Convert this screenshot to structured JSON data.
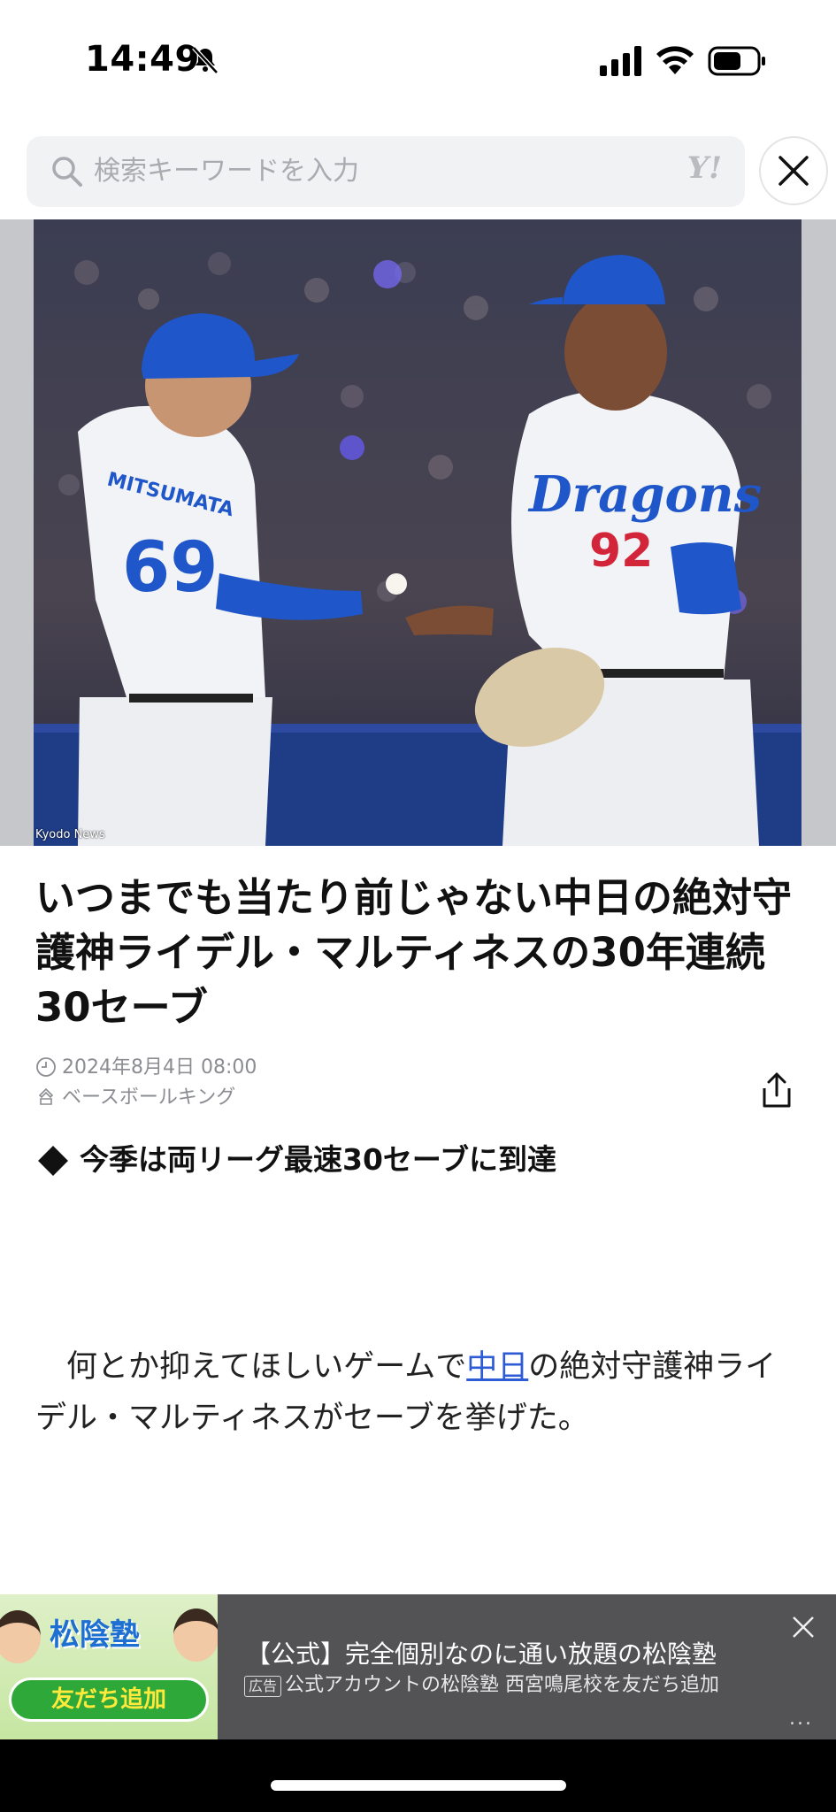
{
  "status_bar": {
    "time": "14:49",
    "icons": [
      "bell-slash-icon",
      "cellular-signal-icon",
      "wifi-icon",
      "battery-icon"
    ]
  },
  "search": {
    "placeholder": "検索キーワードを入力",
    "logo_text": "Y!"
  },
  "hero": {
    "credit": "Kyodo News",
    "jersey_left_name": "MITSUMATA",
    "jersey_left_number": "69",
    "jersey_right_team": "Dragons",
    "jersey_right_number": "92"
  },
  "article": {
    "title": "いつまでも当たり前じゃない中日の絶対守護神ライデル・マルティネスの30年連続30セーブ",
    "date": "2024年8月4日 08:00",
    "source": "ベースボールキング",
    "subheading": "今季は両リーグ最速30セーブに到達",
    "body_before_link": "何とか抑えてほしいゲームで",
    "body_link": "中日",
    "body_after_link": "の絶対守護神ライデル・マルティネスがセーブを挙げた。"
  },
  "ad": {
    "brand": "松陰塾",
    "cta": "友だち追加",
    "title": "【公式】完全個別なのに通い放題の松陰塾",
    "badge": "広告",
    "description": "公式アカウントの松陰塾 西宮鳴尾校を友だち追加",
    "more": "..."
  },
  "colors": {
    "link": "#2e5bd6",
    "ad_background": "#535356",
    "cta_green": "#2fa83a"
  }
}
